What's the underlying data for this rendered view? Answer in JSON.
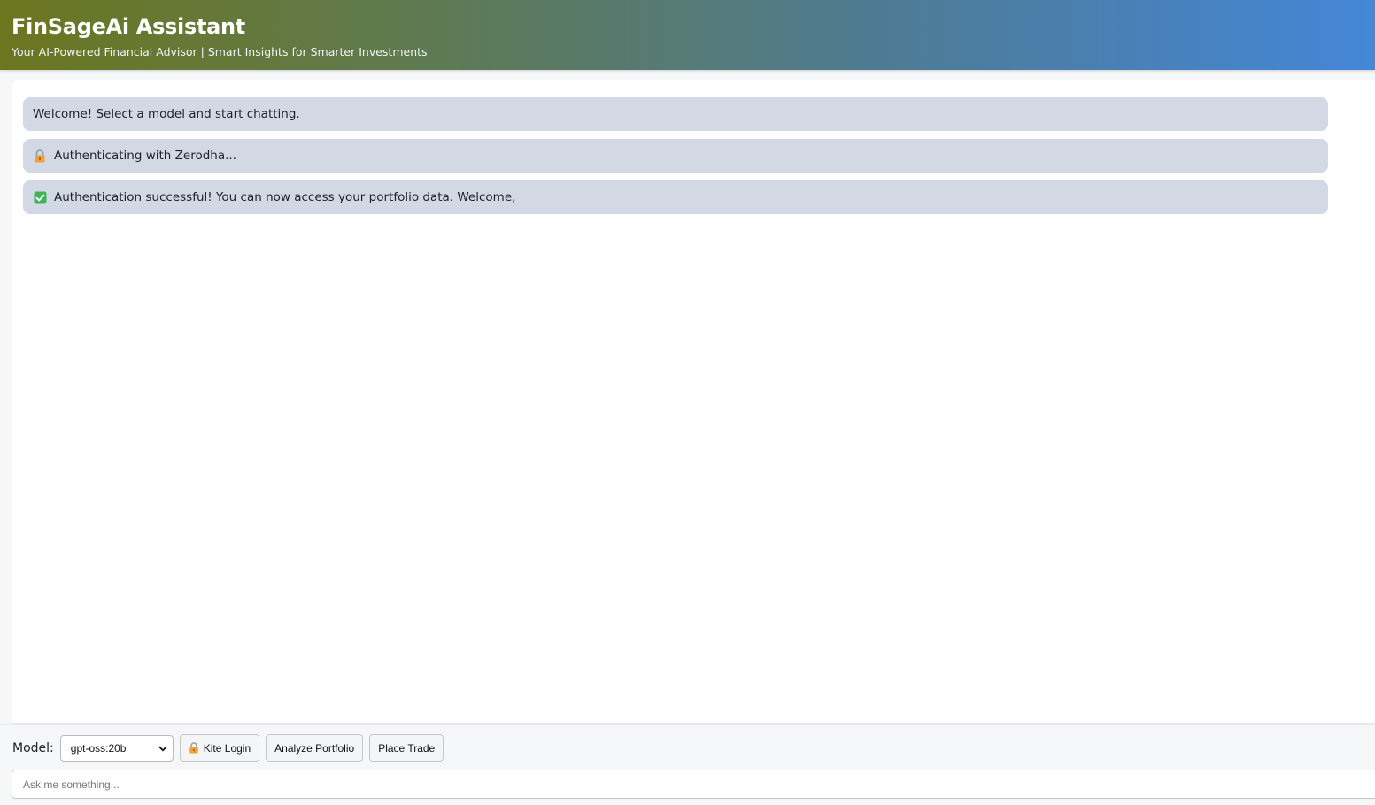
{
  "header": {
    "title": "FinSageAi Assistant",
    "subtitle": "Your AI-Powered Financial Advisor | Smart Insights for Smarter Investments"
  },
  "messages": [
    {
      "icon": "",
      "text": "Welcome! Select a model and start chatting."
    },
    {
      "icon": "lock-icon",
      "text": "Authenticating with Zerodha..."
    },
    {
      "icon": "check-mark-icon",
      "text": "Authentication successful! You can now access your portfolio data. Welcome,"
    }
  ],
  "controls": {
    "model_label": "Model:",
    "model_selected": "gpt-oss:20b",
    "kite_login_label": "Kite Login",
    "analyze_label": "Analyze Portfolio",
    "trade_label": "Place Trade"
  },
  "input": {
    "placeholder": "Ask me something..."
  },
  "colors": {
    "header_gradient_start": "#6b761f",
    "header_gradient_end": "#4486d8",
    "message_bg": "#d2d9e5"
  }
}
